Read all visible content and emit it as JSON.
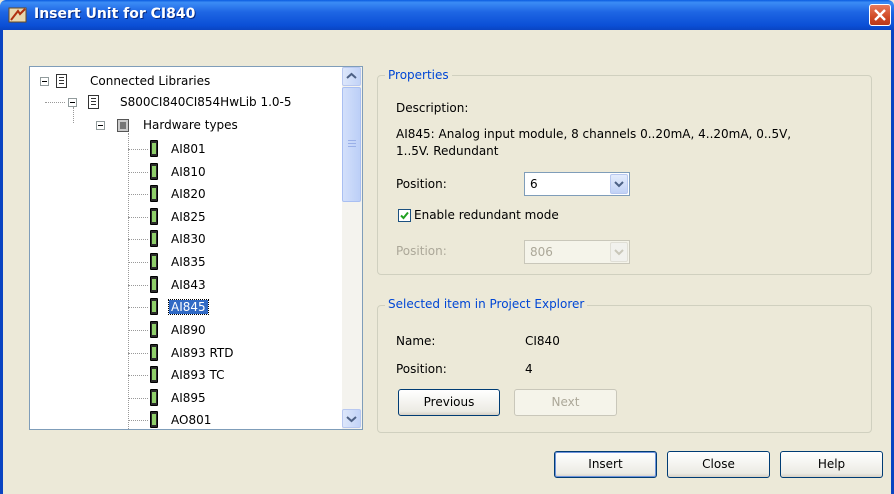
{
  "window": {
    "title": "Insert Unit for CI840",
    "close_icon": "close-icon",
    "app_icon": "abb-tool-icon"
  },
  "tree": {
    "root": "Connected Libraries",
    "library": "S800CI840CI854HwLib 1.0-5",
    "folder": "Hardware types",
    "items": [
      "AI801",
      "AI810",
      "AI820",
      "AI825",
      "AI830",
      "AI835",
      "AI843",
      "AI845",
      "AI890",
      "AI893 RTD",
      "AI893 TC",
      "AI895",
      "AO801"
    ],
    "selected": "AI845"
  },
  "properties": {
    "legend": "Properties",
    "description_label": "Description:",
    "description_line1": "AI845: Analog input module, 8 channels 0..20mA, 4..20mA, 0..5V,",
    "description_line2": "1..5V. Redundant",
    "position_label": "Position:",
    "position_value": "6",
    "redundant_label": "Enable redundant mode",
    "redundant_checked": true,
    "position2_label": "Position:",
    "position2_value": "806"
  },
  "selected_item": {
    "legend": "Selected item in Project Explorer",
    "name_label": "Name:",
    "name_value": "CI840",
    "position_label": "Position:",
    "position_value": "4",
    "previous_label": "Previous",
    "next_label": "Next"
  },
  "buttons": {
    "insert": "Insert",
    "close": "Close",
    "help": "Help"
  },
  "colors": {
    "title_bar": "#0a5be0",
    "selection": "#316ac5",
    "legend_text": "#0046d5"
  }
}
